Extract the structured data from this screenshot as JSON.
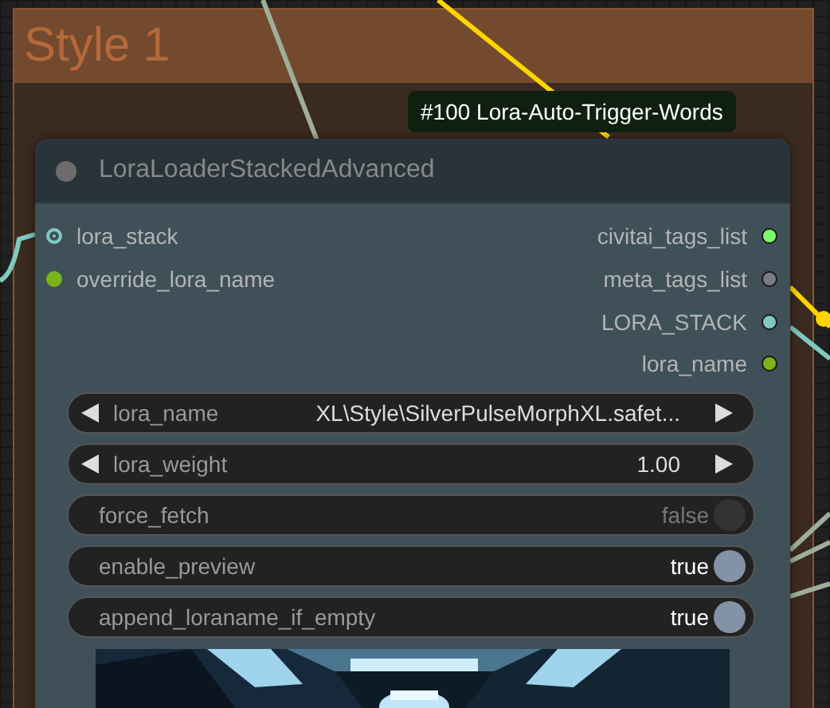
{
  "group": {
    "title": "Style 1"
  },
  "badge": {
    "text": "#100 Lora-Auto-Trigger-Words"
  },
  "node": {
    "title": "LoraLoaderStackedAdvanced",
    "inputs": [
      {
        "name": "lora_stack",
        "color": "#7fc9c0",
        "kind": "list"
      },
      {
        "name": "override_lora_name",
        "color": "#7bb31a",
        "kind": "dot"
      }
    ],
    "outputs": [
      {
        "name": "civitai_tags_list",
        "color": "#7cfc6c"
      },
      {
        "name": "meta_tags_list",
        "color": "#7a7a8a"
      },
      {
        "name": "LORA_STACK",
        "color": "#7fc9c0"
      },
      {
        "name": "lora_name",
        "color": "#7bb31a"
      }
    ],
    "widgets": [
      {
        "kind": "combo",
        "label": "lora_name",
        "value": "XL\\Style\\SilverPulseMorphXL.safet..."
      },
      {
        "kind": "number",
        "label": "lora_weight",
        "value": "1.00"
      },
      {
        "kind": "toggle",
        "label": "force_fetch",
        "value": "false",
        "on": false
      },
      {
        "kind": "toggle",
        "label": "enable_preview",
        "value": "true",
        "on": true
      },
      {
        "kind": "toggle",
        "label": "append_loraname_if_empty",
        "value": "true",
        "on": true
      }
    ]
  }
}
